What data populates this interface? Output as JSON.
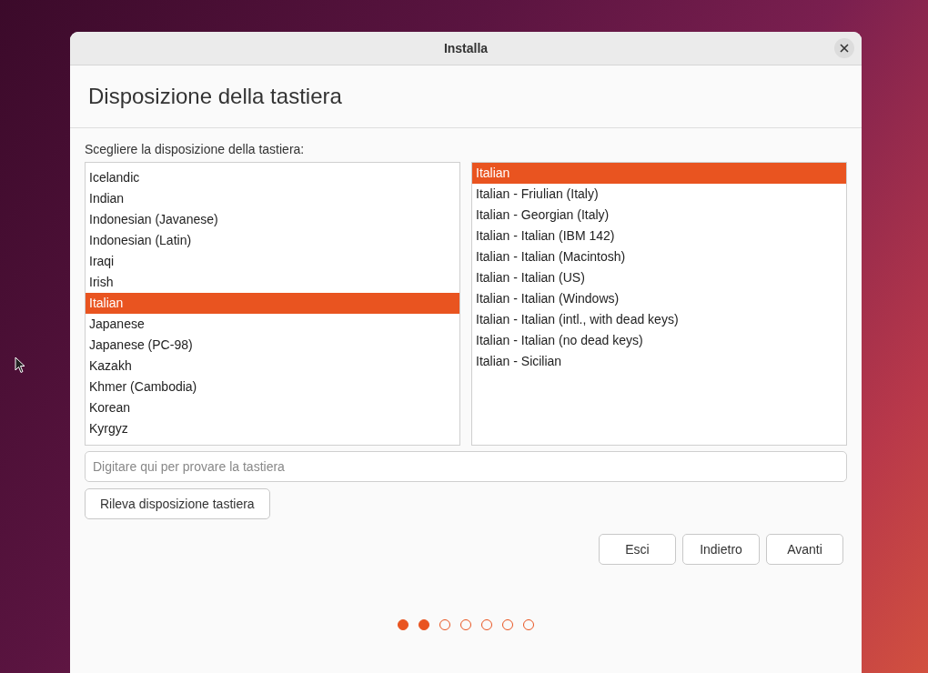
{
  "window": {
    "title": "Installa"
  },
  "page_title": "Disposizione della tastiera",
  "layout_label": "Scegliere la disposizione della tastiera:",
  "layouts": [
    {
      "label": "Icelandic",
      "selected": false
    },
    {
      "label": "Indian",
      "selected": false
    },
    {
      "label": "Indonesian (Javanese)",
      "selected": false
    },
    {
      "label": "Indonesian (Latin)",
      "selected": false
    },
    {
      "label": "Iraqi",
      "selected": false
    },
    {
      "label": "Irish",
      "selected": false
    },
    {
      "label": "Italian",
      "selected": true
    },
    {
      "label": "Japanese",
      "selected": false
    },
    {
      "label": "Japanese (PC-98)",
      "selected": false
    },
    {
      "label": "Kazakh",
      "selected": false
    },
    {
      "label": "Khmer (Cambodia)",
      "selected": false
    },
    {
      "label": "Korean",
      "selected": false
    },
    {
      "label": "Kyrgyz",
      "selected": false
    }
  ],
  "variants": [
    {
      "label": "Italian",
      "selected": true
    },
    {
      "label": "Italian - Friulian (Italy)",
      "selected": false
    },
    {
      "label": "Italian - Georgian (Italy)",
      "selected": false
    },
    {
      "label": "Italian - Italian (IBM 142)",
      "selected": false
    },
    {
      "label": "Italian - Italian (Macintosh)",
      "selected": false
    },
    {
      "label": "Italian - Italian (US)",
      "selected": false
    },
    {
      "label": "Italian - Italian (Windows)",
      "selected": false
    },
    {
      "label": "Italian - Italian (intl., with dead keys)",
      "selected": false
    },
    {
      "label": "Italian - Italian (no dead keys)",
      "selected": false
    },
    {
      "label": "Italian - Sicilian",
      "selected": false
    }
  ],
  "test_field": {
    "placeholder": "Digitare qui per provare la tastiera"
  },
  "detect_button": "Rileva disposizione tastiera",
  "buttons": [
    "Esci",
    "Indietro",
    "Avanti"
  ],
  "steps": [
    {
      "completed": true
    },
    {
      "completed": true
    },
    {
      "completed": false
    },
    {
      "completed": false
    },
    {
      "completed": false
    },
    {
      "completed": false
    },
    {
      "completed": false
    }
  ]
}
